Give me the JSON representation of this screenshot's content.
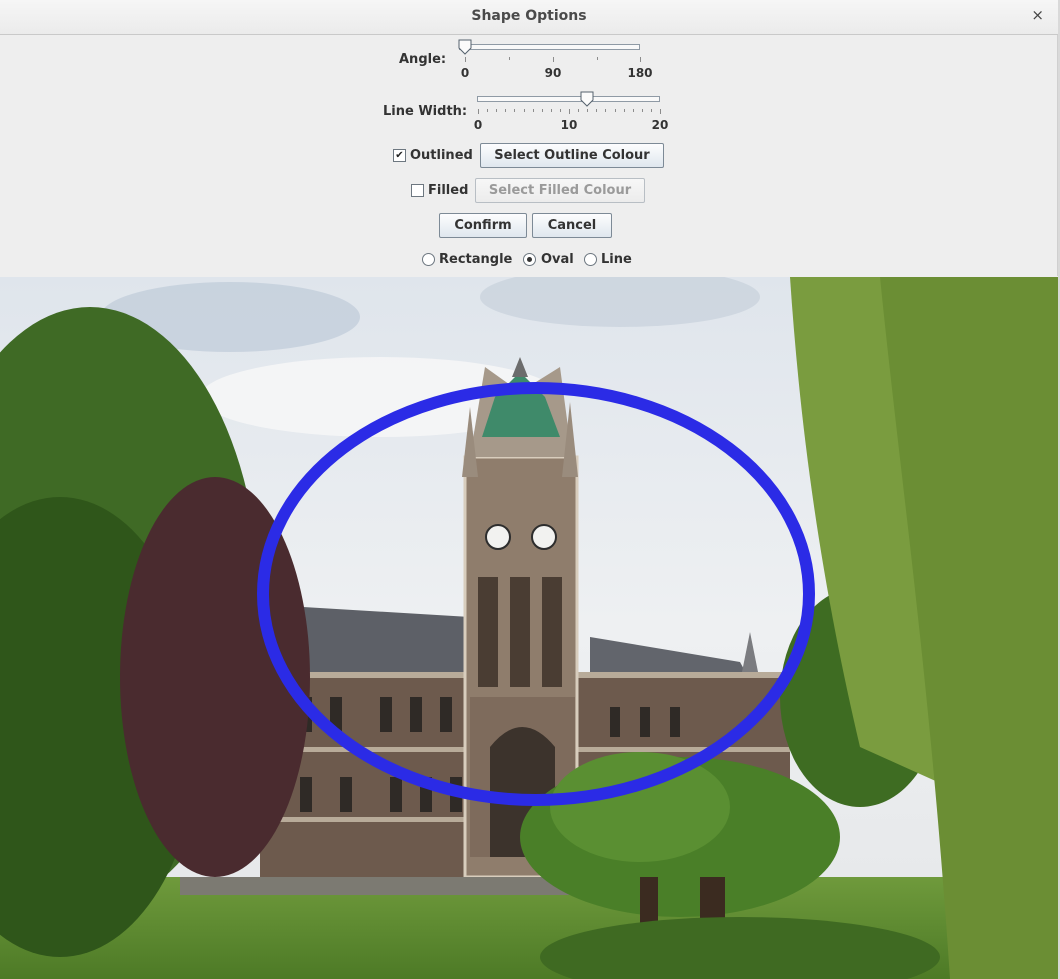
{
  "window": {
    "title": "Shape Options",
    "close_glyph": "×"
  },
  "angle": {
    "label": "Angle:",
    "min": 0,
    "max": 180,
    "value": 0,
    "ticks": [
      "0",
      "90",
      "180"
    ]
  },
  "line_width": {
    "label": "Line Width:",
    "min": 0,
    "max": 20,
    "value": 12,
    "ticks": [
      "0",
      "10",
      "20"
    ]
  },
  "outlined": {
    "label": "Outlined",
    "checked": true,
    "check_glyph": "✔",
    "button": "Select Outline Colour"
  },
  "filled": {
    "label": "Filled",
    "checked": false,
    "button": "Select Filled Colour"
  },
  "actions": {
    "confirm": "Confirm",
    "cancel": "Cancel"
  },
  "shape_type": {
    "options": [
      "Rectangle",
      "Oval",
      "Line"
    ],
    "selected": "Oval"
  },
  "canvas": {
    "oval_outline_color": "#2b2be6",
    "icons": [
      "clock-tower-photo"
    ]
  }
}
